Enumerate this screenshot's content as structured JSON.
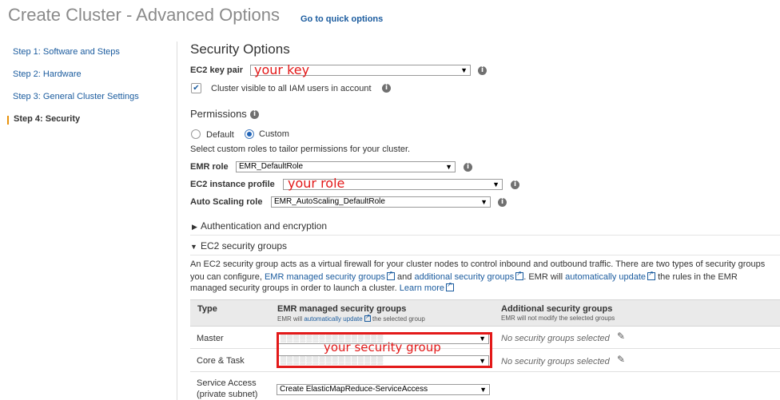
{
  "header": {
    "title": "Create Cluster - Advanced Options",
    "quick_link": "Go to quick options"
  },
  "steps": [
    {
      "label": "Step 1: Software and Steps",
      "active": false
    },
    {
      "label": "Step 2: Hardware",
      "active": false
    },
    {
      "label": "Step 3: General Cluster Settings",
      "active": false
    },
    {
      "label": "Step 4: Security",
      "active": true
    }
  ],
  "security_options": {
    "title": "Security Options",
    "key_pair_label": "EC2 key pair",
    "key_pair_value": "your key",
    "visible_checkbox_label": "Cluster visible to all IAM users in account",
    "visible_checked": true
  },
  "permissions": {
    "title": "Permissions",
    "option_default": "Default",
    "option_custom": "Custom",
    "selected": "Custom",
    "description": "Select custom roles to tailor permissions for your cluster.",
    "emr_role_label": "EMR role",
    "emr_role_value": "EMR_DefaultRole",
    "instance_profile_label": "EC2 instance profile",
    "instance_profile_value": "your role",
    "autoscaling_label": "Auto Scaling role",
    "autoscaling_value": "EMR_AutoScaling_DefaultRole"
  },
  "auth_section": {
    "title": "Authentication and encryption"
  },
  "sg_section": {
    "title": "EC2 security groups",
    "desc_line1": "An EC2 security group acts as a virtual firewall for your cluster nodes to control inbound and outbound traffic. There are two types of security groups",
    "desc_line2_a": "you can configure,",
    "desc_link1": "EMR managed security groups",
    "desc_line2_b": "and",
    "desc_link2": "additional security groups",
    "desc_line2_c": ". EMR will",
    "desc_link3": "automatically update",
    "desc_line2_d": "the rules in the EMR",
    "desc_line3_a": "managed security groups in order to launch a cluster.",
    "desc_link4": "Learn more"
  },
  "sg_table": {
    "col_type": "Type",
    "col_managed": "EMR managed security groups",
    "col_managed_sub_a": "EMR will",
    "col_managed_sub_link": "automatically update",
    "col_managed_sub_b": "the selected group",
    "col_additional": "Additional security groups",
    "col_additional_sub": "EMR will not modify the selected groups",
    "rows": [
      {
        "type": "Master",
        "additional": "No security groups selected"
      },
      {
        "type": "Core & Task",
        "additional": "No security groups selected"
      }
    ],
    "service_access_label_1": "Service Access",
    "service_access_label_2": "(private subnet)",
    "service_access_value": "Create ElasticMapReduce-ServiceAccess",
    "overlay_label": "your security group"
  }
}
